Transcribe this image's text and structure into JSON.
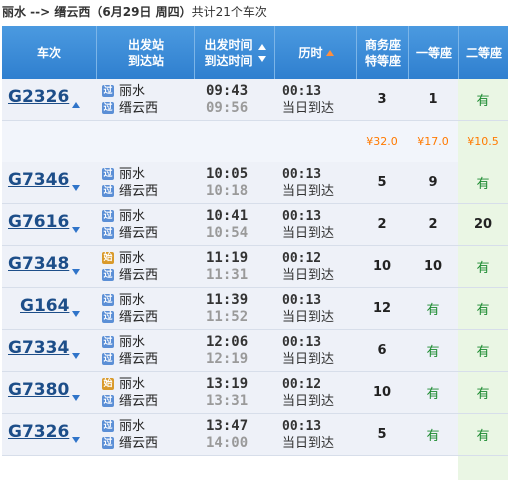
{
  "caption": {
    "route": "丽水 --> 缙云西（6月29日  周四）",
    "count_prefix": "共计",
    "count": "21",
    "count_suffix": "个车次"
  },
  "header": {
    "train": "车次",
    "stations": [
      "出发站",
      "到达站"
    ],
    "times": [
      "出发时间",
      "到达时间"
    ],
    "duration": "历时",
    "business": [
      "商务座",
      "特等座"
    ],
    "first": "一等座",
    "second": "二等座"
  },
  "colors": {
    "header_bg": "#2f7fcf",
    "available": "#1b8a2f",
    "price": "#ff7a00",
    "row_bg": "#eef1f8"
  },
  "rows": [
    {
      "train": "G2326",
      "from": "丽水",
      "to": "缙云西",
      "from_badge": "过",
      "dep": "09:43",
      "arr": "09:56",
      "dur": "00:13",
      "arrive": "当日到达",
      "business": "3",
      "first": "1",
      "second": "有",
      "expanded": true
    },
    {
      "train": "G7346",
      "from": "丽水",
      "to": "缙云西",
      "from_badge": "过",
      "dep": "10:05",
      "arr": "10:18",
      "dur": "00:13",
      "arrive": "当日到达",
      "business": "5",
      "first": "9",
      "second": "有"
    },
    {
      "train": "G7616",
      "from": "丽水",
      "to": "缙云西",
      "from_badge": "过",
      "dep": "10:41",
      "arr": "10:54",
      "dur": "00:13",
      "arrive": "当日到达",
      "business": "2",
      "first": "2",
      "second": "20"
    },
    {
      "train": "G7348",
      "from": "丽水",
      "to": "缙云西",
      "from_badge": "始",
      "dep": "11:19",
      "arr": "11:31",
      "dur": "00:12",
      "arrive": "当日到达",
      "business": "10",
      "first": "10",
      "second": "有"
    },
    {
      "train": "G164",
      "from": "丽水",
      "to": "缙云西",
      "from_badge": "过",
      "dep": "11:39",
      "arr": "11:52",
      "dur": "00:13",
      "arrive": "当日到达",
      "business": "12",
      "first": "有",
      "second": "有"
    },
    {
      "train": "G7334",
      "from": "丽水",
      "to": "缙云西",
      "from_badge": "过",
      "dep": "12:06",
      "arr": "12:19",
      "dur": "00:13",
      "arrive": "当日到达",
      "business": "6",
      "first": "有",
      "second": "有"
    },
    {
      "train": "G7380",
      "from": "丽水",
      "to": "缙云西",
      "from_badge": "始",
      "dep": "13:19",
      "arr": "13:31",
      "dur": "00:12",
      "arrive": "当日到达",
      "business": "10",
      "first": "有",
      "second": "有"
    },
    {
      "train": "G7326",
      "from": "丽水",
      "to": "缙云西",
      "from_badge": "过",
      "dep": "13:47",
      "arr": "14:00",
      "dur": "00:13",
      "arrive": "当日到达",
      "business": "5",
      "first": "有",
      "second": "有"
    }
  ],
  "prices": {
    "business": "¥32.0",
    "first": "¥17.0",
    "second": "¥10.5"
  },
  "to_badge": "过"
}
